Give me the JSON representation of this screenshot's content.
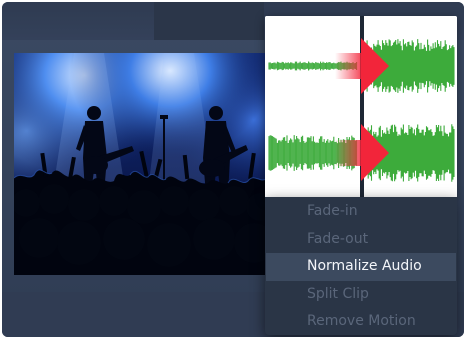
{
  "context_menu": {
    "items": [
      {
        "label": "Fade-in",
        "state": "disabled"
      },
      {
        "label": "Fade-out",
        "state": "disabled"
      },
      {
        "label": "Normalize Audio",
        "state": "highlighted"
      },
      {
        "label": "Split Clip",
        "state": "disabled"
      },
      {
        "label": "Remove Motion",
        "state": "disabled"
      }
    ]
  },
  "preview": {
    "subject": "concert-stage-image"
  },
  "waveform": {
    "before_color": "#3dab3b",
    "after_color": "#3dab3b",
    "arrow_color": "#f2253a",
    "icon": "normalize-arrow-icon"
  }
}
